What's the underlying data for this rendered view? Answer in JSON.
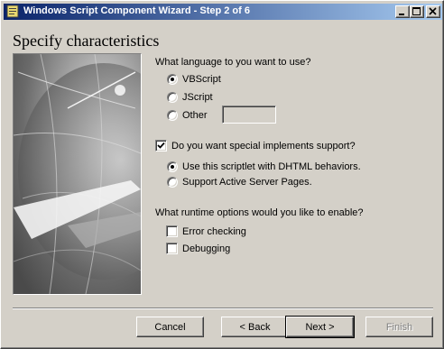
{
  "window": {
    "title": "Windows Script Component Wizard - Step 2 of 6"
  },
  "page": {
    "heading": "Specify characteristics"
  },
  "language": {
    "question": "What language to you want to use?",
    "options": [
      "VBScript",
      "JScript",
      "Other"
    ],
    "selected": "VBScript",
    "other_value": ""
  },
  "implements": {
    "checkbox_label": "Do you want special implements support?",
    "checked": true,
    "options": [
      "Use this scriptlet with DHTML behaviors.",
      "Support Active Server Pages."
    ],
    "selected": "Use this scriptlet with DHTML behaviors."
  },
  "runtime": {
    "question": "What runtime options would you like to enable?",
    "options": [
      {
        "label": "Error checking",
        "checked": false
      },
      {
        "label": "Debugging",
        "checked": false
      }
    ]
  },
  "buttons": {
    "cancel": "Cancel",
    "back": "< Back",
    "next": "Next >",
    "finish": "Finish"
  }
}
